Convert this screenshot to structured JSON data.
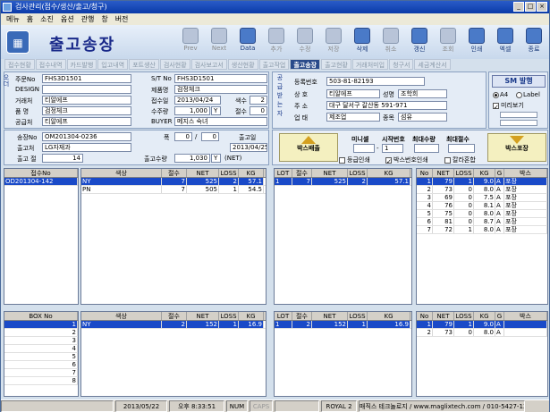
{
  "window": {
    "title": "검사관리(접수/생산/출고/청구)"
  },
  "menu": [
    "메뉴",
    "홈",
    "소진",
    "옵션",
    "관행",
    "창",
    "버전"
  ],
  "header": {
    "title": "출고송장"
  },
  "toolbar": [
    {
      "label": "Prev",
      "enabled": false
    },
    {
      "label": "Next",
      "enabled": false
    },
    {
      "label": "Data",
      "enabled": true
    },
    {
      "label": "추가",
      "enabled": false
    },
    {
      "label": "수정",
      "enabled": false
    },
    {
      "label": "저장",
      "enabled": false
    },
    {
      "label": "삭제",
      "enabled": true
    },
    {
      "label": "취소",
      "enabled": false
    },
    {
      "label": "갱신",
      "enabled": true
    },
    {
      "label": "조회",
      "enabled": false
    },
    {
      "label": "인쇄",
      "enabled": true
    },
    {
      "label": "엑셀",
      "enabled": true
    },
    {
      "label": "종료",
      "enabled": true
    }
  ],
  "tabs": [
    "접수현황",
    "접수내역",
    "카드발행",
    "입고내역",
    "포트생산",
    "검사현황",
    "검사보고서",
    "생산현황",
    "출고작업",
    "출고송장",
    "출고현황",
    "거래처미입",
    "청구서",
    "세금계산서"
  ],
  "active_tab": "출고송장",
  "order": {
    "side_label": "오더",
    "order_no_label": "주문No",
    "order_no": "FHS3D1501",
    "st_no_label": "S/T No",
    "st_no": "FHS3D1501",
    "design_label": "DESIGN",
    "design": "",
    "product_label": "제품명",
    "product": "검정체크",
    "client_label": "거래처",
    "client": "티알에프",
    "receipt_date_label": "접수일",
    "receipt_date": "2013/04/24",
    "color_count_label": "색수",
    "color_count": "2",
    "item_label": "품 명",
    "item": "검정체크",
    "order_qty_label": "수주량",
    "order_qty": "1,000",
    "order_unit": "Y",
    "fold_label": "절수",
    "fold": "0",
    "supplier_label": "공급처",
    "supplier": "티알에프",
    "buyer_label": "BUYER",
    "buyer": "메지스 숙녀"
  },
  "shipment": {
    "invoice_no_label": "송장No",
    "invoice_no": "OM201304-0236",
    "width_label": "폭",
    "width_from": "0",
    "width_to": "0",
    "ship_date_label": "출고일",
    "ship_date": "2013/04/25",
    "destination_label": "출고처",
    "destination": "LG자재과",
    "ship_count_label": "출고 절",
    "ship_count": "14",
    "ship_qty_label": "출고수량",
    "ship_qty": "1,030",
    "ship_unit": "Y",
    "ship_net": "(NET)"
  },
  "supplier": {
    "side_label": "공급받는자",
    "reg_no_label": "등록번호",
    "reg_no": "503-81-82193",
    "company_label": "상 호",
    "company": "티알에프",
    "ceo_label": "성명",
    "ceo": "조학희",
    "address_label": "주 소",
    "address": "대구 달서구 갈산동 591-971",
    "business_label": "업 태",
    "business": "제조업",
    "category_label": "종목",
    "category": "섬유"
  },
  "print_options": {
    "sm_button": "SM 발행",
    "paper_a4": "A4",
    "paper_label": "Label",
    "preview": "미리보기",
    "box_btn": "박스배출",
    "box_pack_btn": "박스포장",
    "mini_label": "미니셀",
    "start_no_label": "시작번호",
    "max_qty_label": "최대수량",
    "max_fold_label": "최대절수",
    "mini_value": "",
    "start_no": "1",
    "grade_print": "등급인쇄",
    "box_no_print": "박스번호인쇄",
    "color_mix": "칼라혼합"
  },
  "receipt_grid": {
    "columns": [
      "접수No"
    ],
    "rows": [
      [
        "OD201304-142"
      ]
    ]
  },
  "color_grid": {
    "columns": [
      "색상",
      "절수",
      "NET",
      "LOSS",
      "KG"
    ],
    "rows": [
      [
        "NY",
        "7",
        "525",
        "2",
        "57.1"
      ],
      [
        "PN",
        "7",
        "505",
        "1",
        "54.5"
      ]
    ]
  },
  "lot_grid": {
    "columns": [
      "LOT",
      "절수",
      "NET",
      "LOSS",
      "KG"
    ],
    "rows": [
      [
        "1",
        "7",
        "525",
        "2",
        "57.1"
      ]
    ]
  },
  "roll_grid": {
    "columns": [
      "No",
      "NET",
      "LOSS",
      "KG",
      "G",
      "박스"
    ],
    "rows": [
      [
        "1",
        "79",
        "1",
        "9.0",
        "A",
        "포장"
      ],
      [
        "2",
        "73",
        "0",
        "8.0",
        "A",
        "포장"
      ],
      [
        "3",
        "69",
        "0",
        "7.5",
        "A",
        "포장"
      ],
      [
        "4",
        "76",
        "0",
        "8.1",
        "A",
        "포장"
      ],
      [
        "5",
        "75",
        "0",
        "8.0",
        "A",
        "포장"
      ],
      [
        "6",
        "81",
        "0",
        "8.7",
        "A",
        "포장"
      ],
      [
        "7",
        "72",
        "1",
        "8.0",
        "A",
        "포장"
      ]
    ]
  },
  "box_grid": {
    "columns": [
      "BOX No"
    ],
    "rows": [
      [
        "1"
      ],
      [
        "2"
      ],
      [
        "3"
      ],
      [
        "4"
      ],
      [
        "5"
      ],
      [
        "6"
      ],
      [
        "7"
      ],
      [
        "8"
      ]
    ]
  },
  "box_color_grid": {
    "columns": [
      "색상",
      "절수",
      "NET",
      "LOSS",
      "KG"
    ],
    "rows": [
      [
        "NY",
        "2",
        "152",
        "1",
        "16.9"
      ]
    ]
  },
  "box_lot_grid": {
    "columns": [
      "LOT",
      "절수",
      "NET",
      "LOSS",
      "KG"
    ],
    "rows": [
      [
        "1",
        "2",
        "152",
        "1",
        "16.9"
      ]
    ]
  },
  "box_roll_grid": {
    "columns": [
      "No",
      "NET",
      "LOSS",
      "KG",
      "G",
      "박스"
    ],
    "rows": [
      [
        "1",
        "79",
        "1",
        "9.0",
        "A",
        ""
      ],
      [
        "2",
        "73",
        "0",
        "8.0",
        "A",
        ""
      ]
    ]
  },
  "status": {
    "date": "2013/05/22",
    "time": "오후 8:33:51",
    "num": "NUM",
    "caps": "CAPS",
    "user": "ROYAL 2",
    "company": "매직스 테크놀로지 / www.maglixtech.com / 010-5427-1357"
  }
}
